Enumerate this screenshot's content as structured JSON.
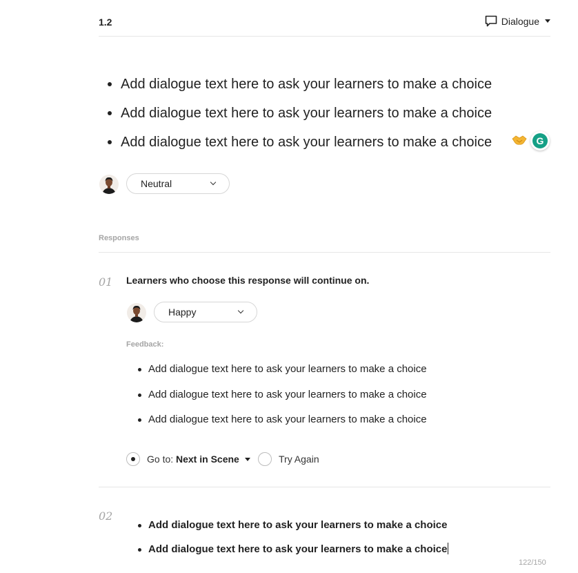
{
  "header": {
    "scene_number": "1.2",
    "type_label": "Dialogue",
    "type_icon": "speech-bubble-icon"
  },
  "dialogue": {
    "lines": [
      "Add dialogue text here to ask your learners to make a choice",
      "Add dialogue text here to ask your learners to make a choice",
      "Add dialogue text here to ask your learners to make a choice"
    ],
    "expression": "Neutral"
  },
  "extensions": {
    "handshake_icon": "handshake-icon",
    "grammarly_letter": "G",
    "grammarly_color": "#15a086"
  },
  "responses": {
    "label": "Responses",
    "items": [
      {
        "number": "01",
        "title": "Learners who choose this response will continue on.",
        "expression": "Happy",
        "feedback_label": "Feedback:",
        "feedback_lines": [
          "Add dialogue text here to ask your learners to make a choice",
          "Add dialogue text here to ask your learners to make a choice",
          "Add dialogue text here to ask your learners to make a choice"
        ],
        "goto_label": "Go to:",
        "goto_value": "Next in Scene",
        "try_again_label": "Try Again"
      },
      {
        "number": "02",
        "lines": [
          "Add dialogue text here to ask your learners to make a choice",
          "Add dialogue text here to ask your learners to make a choice"
        ],
        "char_count": "122/150"
      }
    ]
  }
}
